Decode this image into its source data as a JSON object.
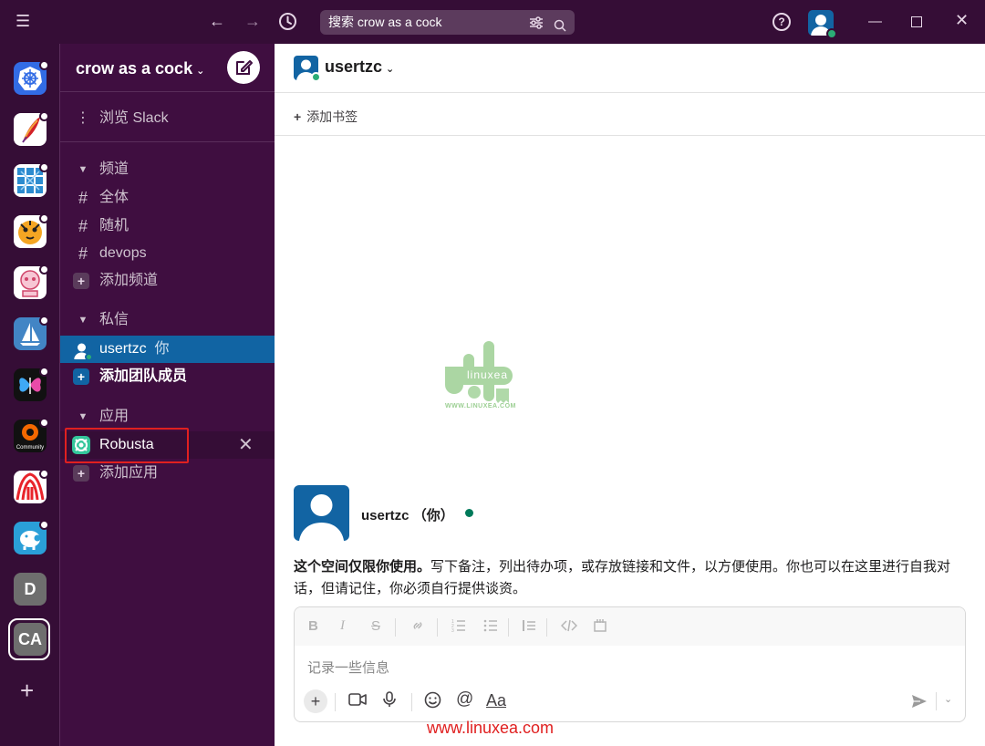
{
  "titlebar": {
    "search_text": "搜索 crow as a cock"
  },
  "workspaces": {
    "letters": [
      "D",
      "CA"
    ]
  },
  "sidebar": {
    "workspace_name": "crow as a cock",
    "browse_label": "浏览 Slack",
    "channels_section": "频道",
    "channels": [
      "全体",
      "随机",
      "devops"
    ],
    "add_channel": "添加频道",
    "dm_section": "私信",
    "dm_user": "usertzc",
    "dm_you": "你",
    "add_member": "添加团队成员",
    "apps_section": "应用",
    "app_name": "Robusta",
    "add_app": "添加应用"
  },
  "main": {
    "channel_title": "usertzc",
    "add_bookmark": "添加书签",
    "watermark_text": "linuxea",
    "watermark_url": "WWW.LINUXEA.COM",
    "profile_name": "usertzc （你）",
    "intro_bold": "这个空间仅限你使用。",
    "intro_rest": "写下备注，列出待办项，或存放链接和文件，以方便使用。你也可以在这里进行自我对话，但请记住，你必须自行提供谈资。",
    "composer_placeholder": "记录一些信息",
    "format_label": "Aa",
    "footer_url": "www.linuxea.com"
  },
  "colors": {
    "sidebar_bg": "#3f0e40",
    "rail_bg": "#350d36",
    "active_item": "#1164a3",
    "online": "#2bac76",
    "highlight": "#e02020"
  }
}
